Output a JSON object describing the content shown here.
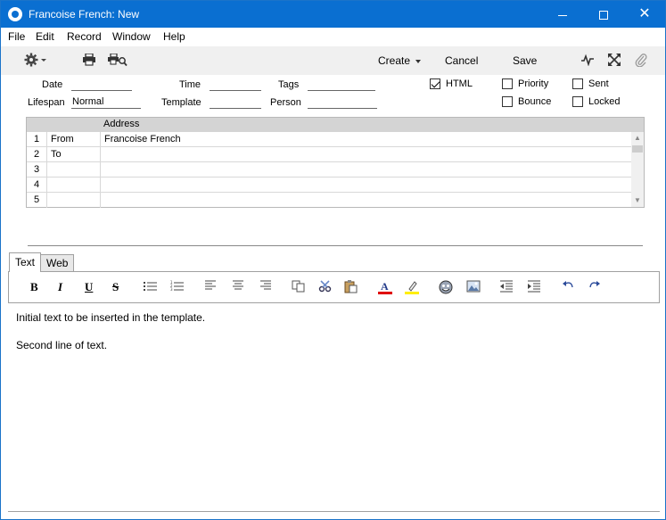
{
  "window": {
    "title": "Francoise French: New",
    "controls": {
      "minimize": "minimize",
      "maximize": "maximize",
      "close": "✕"
    }
  },
  "menu": [
    "File",
    "Edit",
    "Record",
    "Window",
    "Help"
  ],
  "toolbar": {
    "create": "Create",
    "cancel": "Cancel",
    "save": "Save"
  },
  "header": {
    "date_label": "Date",
    "date_value": "",
    "time_label": "Time",
    "time_value": "",
    "tags_label": "Tags",
    "tags_value": "",
    "lifespan_label": "Lifespan",
    "lifespan_value": "Normal",
    "template_label": "Template",
    "template_value": "",
    "person_label": "Person",
    "person_value": "",
    "checkboxes": {
      "html": {
        "label": "HTML",
        "checked": true
      },
      "priority": {
        "label": "Priority",
        "checked": false
      },
      "sent": {
        "label": "Sent",
        "checked": false
      },
      "bounce": {
        "label": "Bounce",
        "checked": false
      },
      "locked": {
        "label": "Locked",
        "checked": false
      }
    }
  },
  "grid": {
    "column_header": "Address",
    "rows": [
      {
        "num": "1",
        "type": "From",
        "address": "Francoise French"
      },
      {
        "num": "2",
        "type": "To",
        "address": ""
      },
      {
        "num": "3",
        "type": "",
        "address": ""
      },
      {
        "num": "4",
        "type": "",
        "address": ""
      },
      {
        "num": "5",
        "type": "",
        "address": ""
      }
    ]
  },
  "tabs": {
    "text": "Text",
    "web": "Web"
  },
  "editor": {
    "line1": "Initial text to be inserted in the template.",
    "line2": "Second line of text."
  },
  "colors": {
    "titlebar": "#0a6fd1",
    "font_color_bar": "#e00000",
    "highlight_bar": "#ffee00"
  }
}
